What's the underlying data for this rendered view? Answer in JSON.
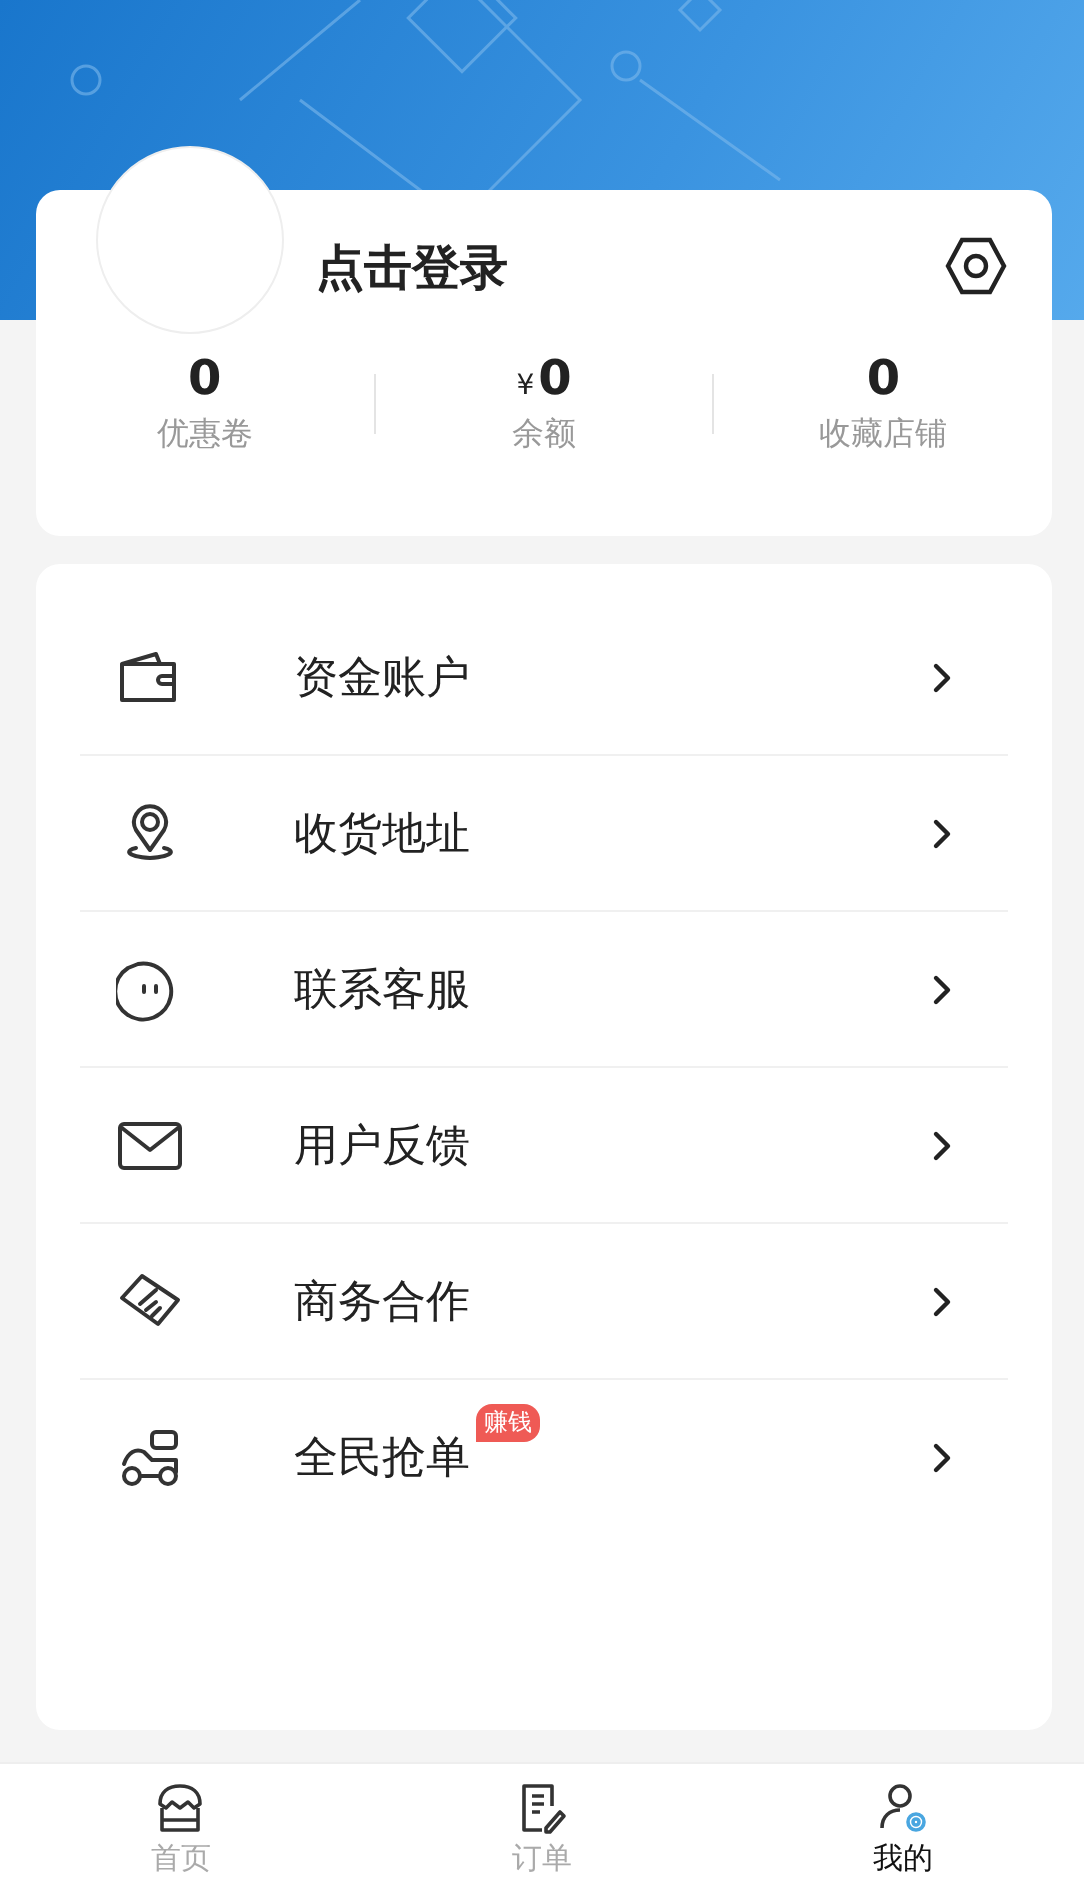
{
  "profile": {
    "login": "点击登录"
  },
  "stats": [
    {
      "value": "0",
      "label": "优惠卷"
    },
    {
      "currency": "¥",
      "value": "0",
      "label": "余额"
    },
    {
      "value": "0",
      "label": "收藏店铺"
    }
  ],
  "menu": [
    {
      "label": "资金账户"
    },
    {
      "label": "收货地址"
    },
    {
      "label": "联系客服"
    },
    {
      "label": "用户反馈"
    },
    {
      "label": "商务合作"
    },
    {
      "label": "全民抢单",
      "badge": "赚钱"
    }
  ],
  "tabs": [
    {
      "label": "首页",
      "selected": false
    },
    {
      "label": "订单",
      "selected": false
    },
    {
      "label": "我的",
      "selected": true
    }
  ]
}
